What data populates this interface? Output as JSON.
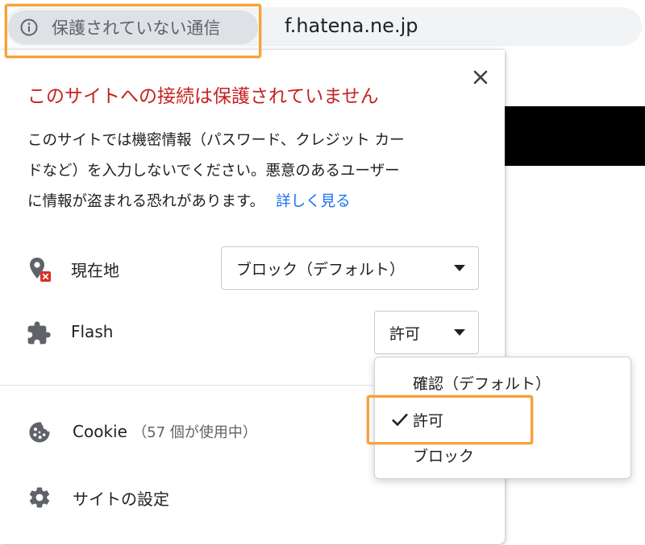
{
  "browser": {
    "security_chip_text": "保護されていない通信",
    "url": "f.hatena.ne.jp"
  },
  "popup": {
    "title": "このサイトへの接続は保護されていません",
    "description_lines": [
      "このサイトでは機密情報（パスワード、クレジット カー",
      "ドなど）を入力しないでください。悪意のあるユーザー",
      "に情報が盗まれる恐れがあります。"
    ],
    "learn_more": "詳しく見る",
    "permissions": [
      {
        "label": "現在地",
        "icon": "location-blocked-icon",
        "value": "ブロック（デフォルト）"
      },
      {
        "label": "Flash",
        "icon": "puzzle-icon",
        "value": "許可"
      }
    ],
    "cookie": {
      "label": "Cookie",
      "sub": "（57 個が使用中）",
      "icon": "cookie-icon"
    },
    "site_settings": {
      "label": "サイトの設定",
      "icon": "gear-icon"
    }
  },
  "flash_menu": {
    "options": [
      "確認（デフォルト）",
      "許可",
      "ブロック"
    ],
    "selected": "許可"
  },
  "colors": {
    "warning": "#c5221f",
    "link": "#1a73e8",
    "highlight": "#f7a13a"
  }
}
